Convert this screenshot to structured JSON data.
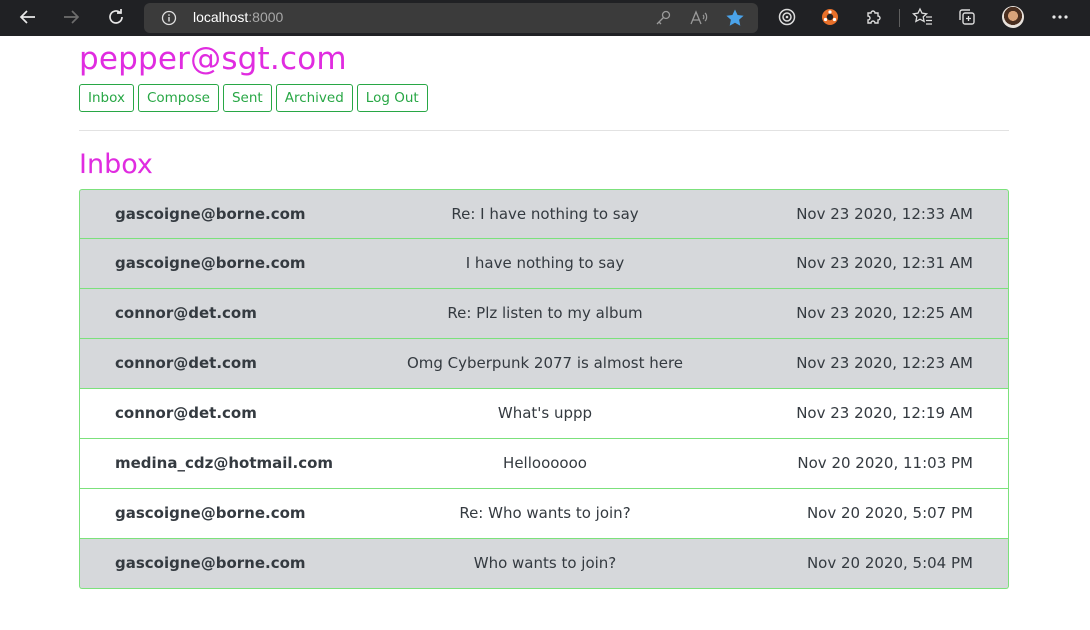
{
  "browser": {
    "url_host": "localhost",
    "url_port": ":8000"
  },
  "user_email": "pepper@sgt.com",
  "nav": {
    "inbox": "Inbox",
    "compose": "Compose",
    "sent": "Sent",
    "archived": "Archived",
    "logout": "Log Out"
  },
  "section_title": "Inbox",
  "colors": {
    "accent_magenta": "#e02ce0",
    "button_green": "#28a745",
    "row_border": "#7ce17c",
    "read_row_bg": "#d6d8db"
  },
  "emails": [
    {
      "sender": "gascoigne@borne.com",
      "subject": "Re: I have nothing to say",
      "timestamp": "Nov 23 2020, 12:33 AM",
      "read": true
    },
    {
      "sender": "gascoigne@borne.com",
      "subject": "I have nothing to say",
      "timestamp": "Nov 23 2020, 12:31 AM",
      "read": true
    },
    {
      "sender": "connor@det.com",
      "subject": "Re: Plz listen to my album",
      "timestamp": "Nov 23 2020, 12:25 AM",
      "read": true
    },
    {
      "sender": "connor@det.com",
      "subject": "Omg Cyberpunk 2077 is almost here",
      "timestamp": "Nov 23 2020, 12:23 AM",
      "read": true
    },
    {
      "sender": "connor@det.com",
      "subject": "What's uppp",
      "timestamp": "Nov 23 2020, 12:19 AM",
      "read": false
    },
    {
      "sender": "medina_cdz@hotmail.com",
      "subject": "Helloooooo",
      "timestamp": "Nov 20 2020, 11:03 PM",
      "read": false
    },
    {
      "sender": "gascoigne@borne.com",
      "subject": "Re: Who wants to join?",
      "timestamp": "Nov 20 2020, 5:07 PM",
      "read": false
    },
    {
      "sender": "gascoigne@borne.com",
      "subject": "Who wants to join?",
      "timestamp": "Nov 20 2020, 5:04 PM",
      "read": true
    }
  ]
}
